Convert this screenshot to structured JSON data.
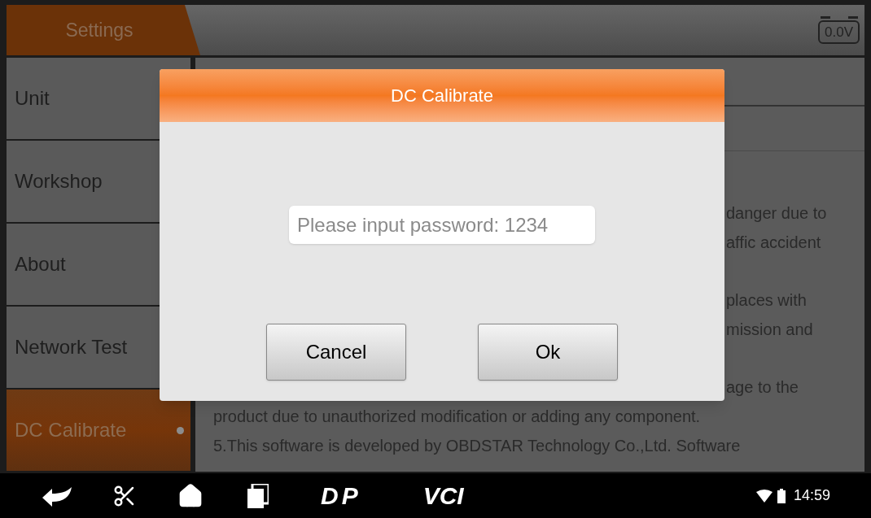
{
  "header": {
    "title": "Settings",
    "voltage": "0.0V"
  },
  "sidebar": {
    "items": [
      {
        "label": "Unit",
        "selected": false
      },
      {
        "label": "Workshop",
        "selected": false
      },
      {
        "label": "About",
        "selected": false
      },
      {
        "label": "Network Test",
        "selected": false
      },
      {
        "label": "DC Calibrate",
        "selected": true
      }
    ]
  },
  "content": {
    "paragraphs": [
      [
        {
          "kind": "fragment",
          "text": "danger due to"
        },
        {
          "kind": "fragment",
          "text": "affic accident"
        }
      ],
      [
        {
          "kind": "fragment",
          "text": "places with"
        },
        {
          "kind": "fragment",
          "text": "mission and"
        }
      ],
      [
        {
          "kind": "fragment",
          "text": "age to the"
        },
        {
          "kind": "full",
          "text": "product due to unauthorized modification or adding any component."
        },
        {
          "kind": "full",
          "text": "5.This software is developed by OBDSTAR Technology Co.,Ltd. Software"
        }
      ]
    ]
  },
  "dialog": {
    "title": "DC Calibrate",
    "password": {
      "placeholder": "Please input password: 1234"
    },
    "buttons": [
      "Cancel",
      "Ok"
    ]
  },
  "nav_bar": {
    "logos": [
      "DP",
      "VCI"
    ],
    "time": "14:59"
  }
}
